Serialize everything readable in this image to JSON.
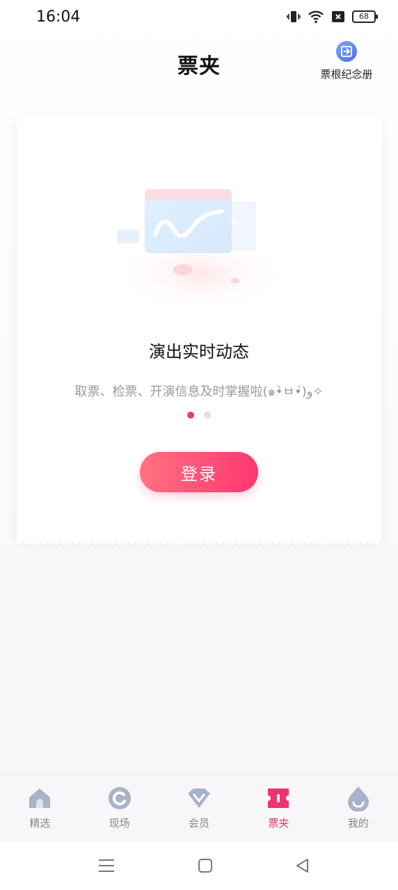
{
  "status_bar": {
    "time": "16:04",
    "battery": "68",
    "icons": [
      "vibrate-icon",
      "wifi-icon",
      "sim-x-icon",
      "battery-icon"
    ]
  },
  "header": {
    "title": "票夹",
    "album_label": "票根纪念册",
    "album_icon": "ticket-album-icon"
  },
  "card": {
    "title": "演出实时动态",
    "description": "取票、检票、开演信息及时掌握啦(๑•̀ㅂ•́)و✧",
    "carousel": {
      "count": 2,
      "active_index": 0
    },
    "login_label": "登录",
    "illustration_icon": "ticket-chart-illustration"
  },
  "tabbar": {
    "active_index": 3,
    "tabs": [
      {
        "label": "精选",
        "icon": "home-icon"
      },
      {
        "label": "现场",
        "icon": "live-icon"
      },
      {
        "label": "会员",
        "icon": "vip-icon"
      },
      {
        "label": "票夹",
        "icon": "ticket-wallet-icon"
      },
      {
        "label": "我的",
        "icon": "profile-icon"
      }
    ]
  },
  "colors": {
    "accent": "#e8336b",
    "button_gradient_start": "#ff7182",
    "button_gradient_end": "#ff3770",
    "inactive_icon": "#a9b2c8"
  }
}
